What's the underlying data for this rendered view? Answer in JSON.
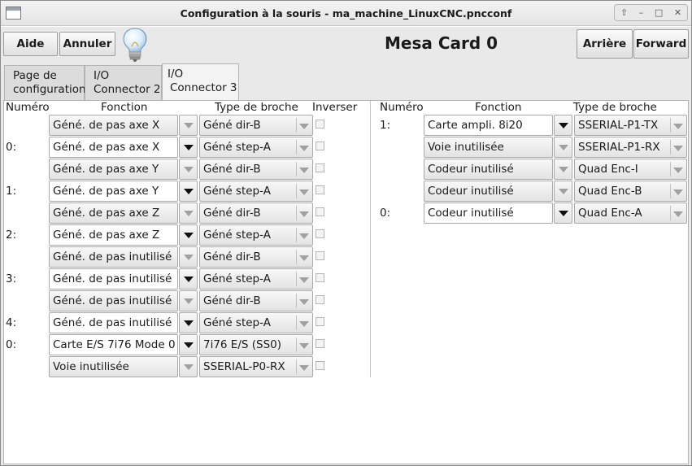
{
  "window": {
    "title": "Configuration à la souris - ma_machine_LinuxCNC.pncconf",
    "controls": [
      "⇧",
      "–",
      "□",
      "✕"
    ]
  },
  "toolbar": {
    "help": "Aide",
    "cancel": "Annuler",
    "card_title": "Mesa Card 0",
    "back": "Arrière",
    "forward": "Forward"
  },
  "tabs": [
    {
      "line1": "Page de",
      "line2": "configuration"
    },
    {
      "line1": "I/O",
      "line2": "Connector 2"
    },
    {
      "line1": "I/O",
      "line2": "Connector 3"
    }
  ],
  "headers": {
    "left": {
      "number": "Numéro",
      "function": "Fonction",
      "pin_type": "Type de broche",
      "invert": "Inverser"
    },
    "right": {
      "number": "Numéro",
      "function": "Fonction",
      "pin_type": "Type de broche"
    }
  },
  "left_rows": [
    {
      "num": "",
      "function": "Géné. de pas axe X",
      "pin_type": "Géné dir-B",
      "editable": false
    },
    {
      "num": "0:",
      "function": "Géné. de pas axe X",
      "pin_type": "Géné step-A",
      "editable": true
    },
    {
      "num": "",
      "function": "Géné. de pas axe Y",
      "pin_type": "Géné dir-B",
      "editable": false
    },
    {
      "num": "1:",
      "function": "Géné. de pas axe Y",
      "pin_type": "Géné step-A",
      "editable": true
    },
    {
      "num": "",
      "function": "Géné. de pas axe Z",
      "pin_type": "Géné dir-B",
      "editable": false
    },
    {
      "num": "2:",
      "function": "Géné. de pas axe Z",
      "pin_type": "Géné step-A",
      "editable": true
    },
    {
      "num": "",
      "function": "Géné. de pas inutilisé",
      "pin_type": "Géné dir-B",
      "editable": false
    },
    {
      "num": "3:",
      "function": "Géné. de pas inutilisé",
      "pin_type": "Géné step-A",
      "editable": true
    },
    {
      "num": "",
      "function": "Géné. de pas inutilisé",
      "pin_type": "Géné dir-B",
      "editable": false
    },
    {
      "num": "4:",
      "function": "Géné. de pas inutilisé",
      "pin_type": "Géné step-A",
      "editable": true
    },
    {
      "num": "0:",
      "function": "Carte E/S 7i76 Mode 0",
      "pin_type": "7i76 E/S (SS0)",
      "editable": true
    },
    {
      "num": "",
      "function": "Voie inutilisée",
      "pin_type": "SSERIAL-P0-RX",
      "editable": false
    }
  ],
  "right_rows": [
    {
      "num": "1:",
      "function": "Carte ampli. 8i20",
      "pin_type": "SSERIAL-P1-TX",
      "editable": true
    },
    {
      "num": "",
      "function": "Voie inutilisée",
      "pin_type": "SSERIAL-P1-RX",
      "editable": false
    },
    {
      "num": "",
      "function": "Codeur inutilisé",
      "pin_type": "Quad Enc-I",
      "editable": false
    },
    {
      "num": "",
      "function": "Codeur inutilisé",
      "pin_type": "Quad Enc-B",
      "editable": false
    },
    {
      "num": "0:",
      "function": "Codeur inutilisé",
      "pin_type": "Quad Enc-A",
      "editable": true
    }
  ]
}
